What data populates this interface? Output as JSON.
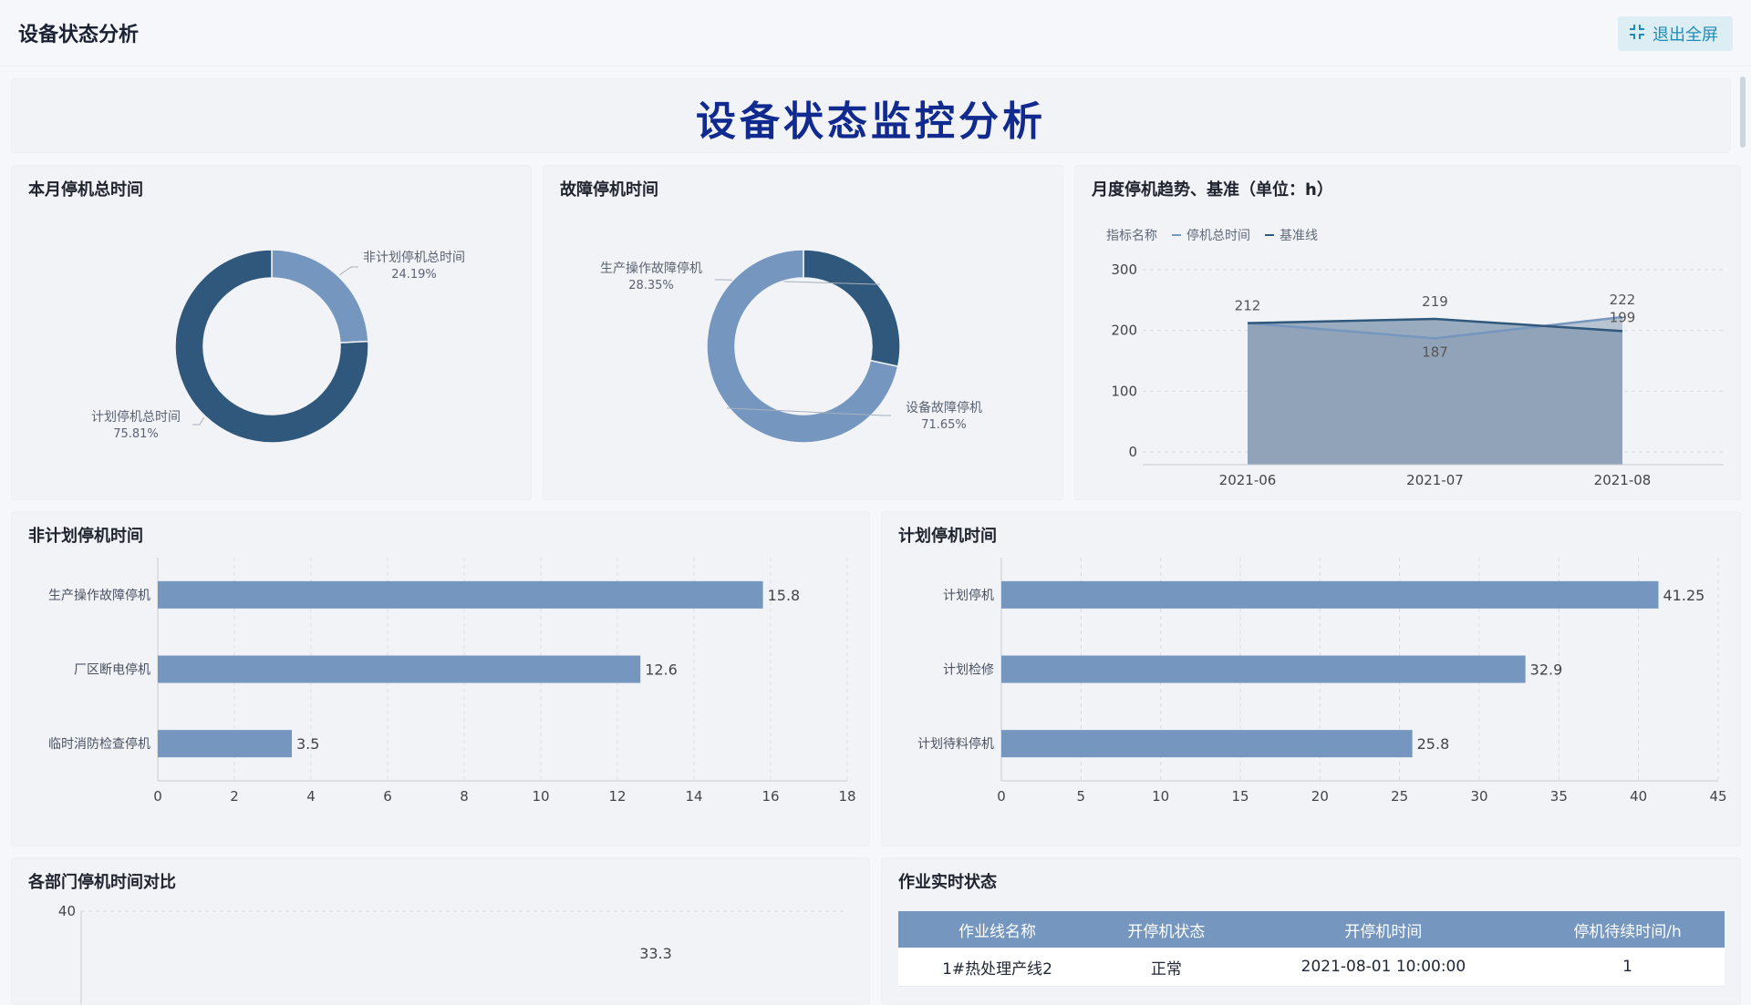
{
  "header": {
    "title": "设备状态分析",
    "exit_label": "退出全屏"
  },
  "banner": {
    "title": "设备状态监控分析"
  },
  "panels": {
    "monthly_total": {
      "title": "本月停机总时间"
    },
    "fault": {
      "title": "故障停机时间"
    },
    "trend": {
      "title": "月度停机趋势、基准（单位：h）"
    },
    "unplanned": {
      "title": "非计划停机时间"
    },
    "planned": {
      "title": "计划停机时间"
    },
    "dept": {
      "title": "各部门停机时间对比"
    },
    "realtime": {
      "title": "作业实时状态"
    }
  },
  "colors": {
    "dark": "#2f587c",
    "light": "#7596be",
    "area": "#8a9db5",
    "grid": "#d9dde4",
    "accent": "#1f8cb5"
  },
  "chart_data": [
    {
      "type": "pie",
      "title": "本月停机总时间",
      "labels": [
        "非计划停机总时间",
        "计划停机总时间"
      ],
      "values": [
        24.19,
        75.81
      ],
      "percent_labels": [
        "24.19%",
        "75.81%"
      ]
    },
    {
      "type": "pie",
      "title": "故障停机时间",
      "labels": [
        "生产操作故障停机",
        "设备故障停机"
      ],
      "values": [
        28.35,
        71.65
      ],
      "percent_labels": [
        "28.35%",
        "71.65%"
      ]
    },
    {
      "type": "line",
      "title": "月度停机趋势、基准（单位：h）",
      "legend_title": "指标名称",
      "x": [
        "2021-06",
        "2021-07",
        "2021-08"
      ],
      "yticks": [
        0,
        100,
        200,
        300
      ],
      "ylim": [
        0,
        300
      ],
      "series": [
        {
          "name": "停机总时间",
          "values": [
            212,
            187,
            222
          ]
        },
        {
          "name": "基准线",
          "values": [
            212,
            219,
            199
          ]
        }
      ]
    },
    {
      "type": "bar",
      "title": "非计划停机时间",
      "categories": [
        "生产操作故障停机",
        "厂区断电停机",
        "临时消防检查停机"
      ],
      "values": [
        15.8,
        12.6,
        3.5
      ],
      "xticks": [
        0,
        2,
        4,
        6,
        8,
        10,
        12,
        14,
        16,
        18
      ],
      "xlim": [
        0,
        18
      ]
    },
    {
      "type": "bar",
      "title": "计划停机时间",
      "categories": [
        "计划停机",
        "计划检修",
        "计划待料停机"
      ],
      "values": [
        41.25,
        32.9,
        25.8
      ],
      "xticks": [
        0,
        5,
        10,
        15,
        20,
        25,
        30,
        35,
        40,
        45
      ],
      "xlim": [
        0,
        45
      ]
    },
    {
      "type": "bar",
      "title": "各部门停机时间对比",
      "yticks": [
        40
      ],
      "visible_value_labels": [
        "33.3"
      ]
    },
    {
      "type": "table",
      "title": "作业实时状态",
      "columns": [
        "作业线名称",
        "开停机状态",
        "开停机时间",
        "停机待续时间/h"
      ],
      "rows": [
        [
          "1#热处理产线2",
          "正常",
          "2021-08-01 10:00:00",
          "1"
        ]
      ]
    }
  ]
}
